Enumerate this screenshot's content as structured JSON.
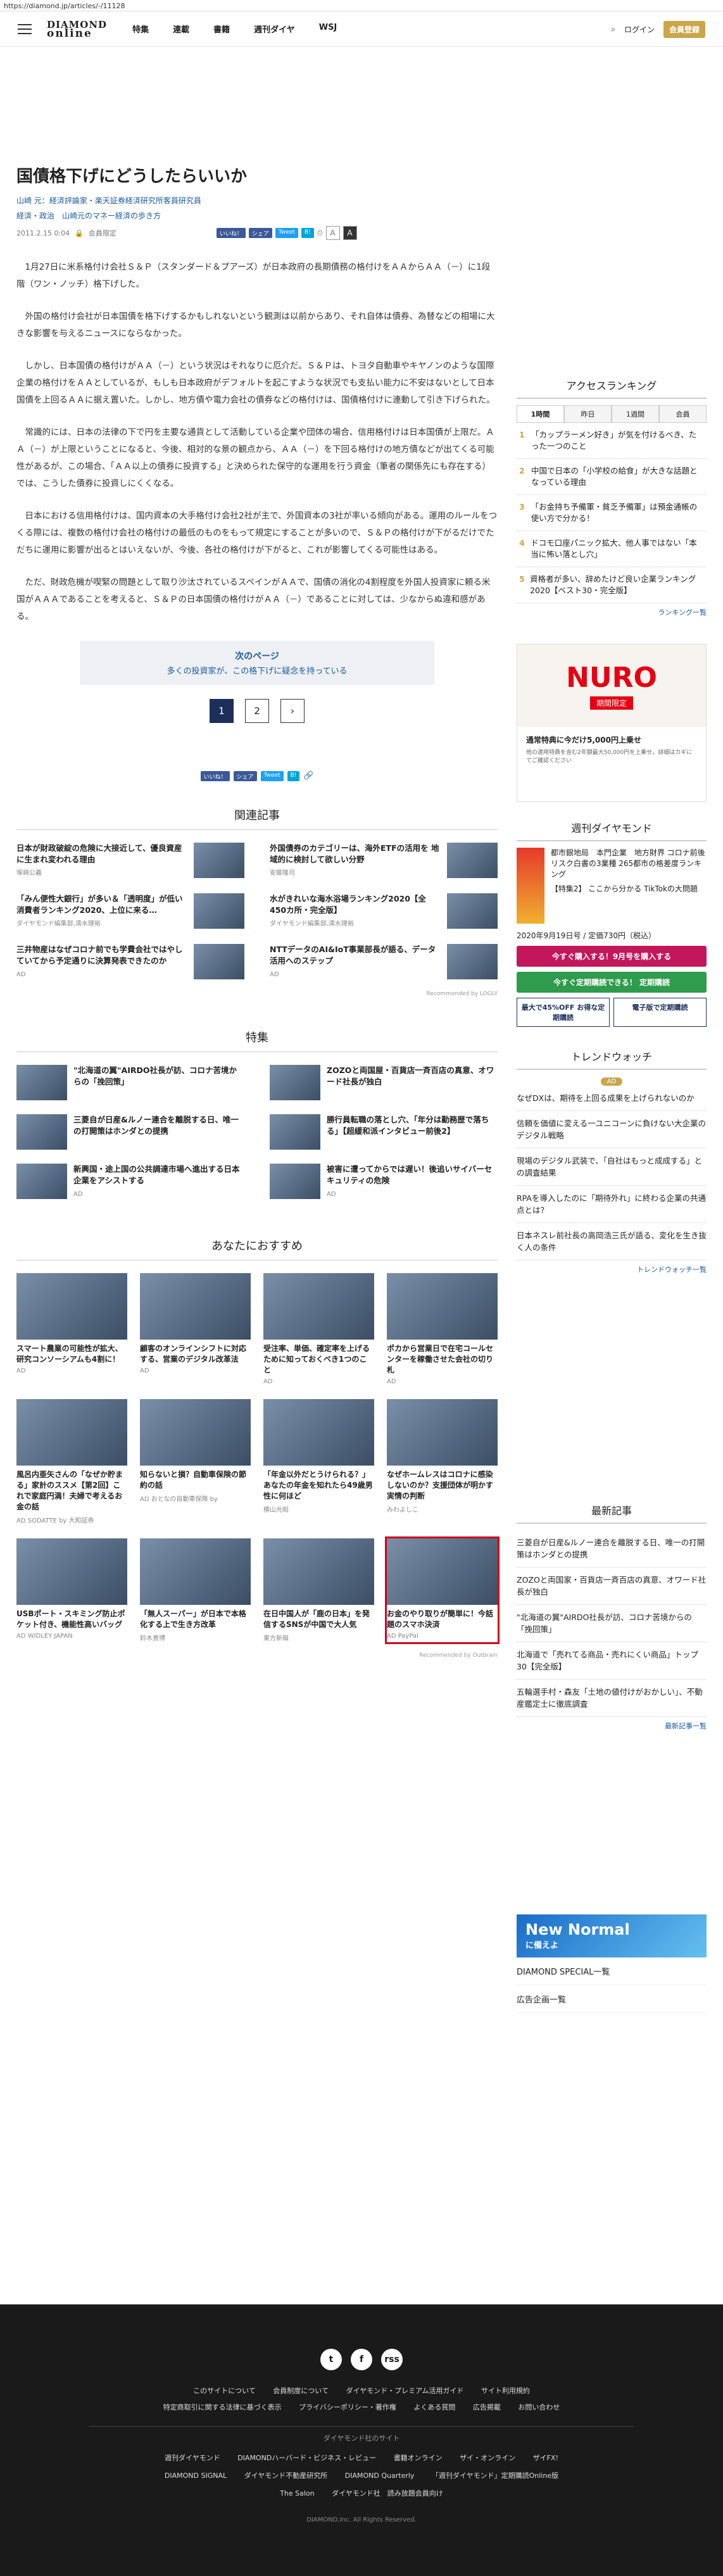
{
  "url": "https://diamond.jp/articles/-/11128",
  "header": {
    "logo_line1": "DIAMOND",
    "logo_line2": "online",
    "nav": [
      "特集",
      "連載",
      "書籍",
      "週刊ダイヤ",
      "WSJ"
    ],
    "login": "ログイン",
    "member": "会員登録"
  },
  "article": {
    "title": "国債格下げにどうしたらいいか",
    "author": "山崎 元：経済評論家・楽天証券経済研究所客員研究員",
    "categories": "経済・政治　山崎元のマネー経済の歩き方",
    "date": "2011.2.15 0:04",
    "print_label": "会員限定",
    "share": {
      "fb": "いいね！",
      "share": "シェア",
      "tweet": "Tweet",
      "hatena": "B!"
    },
    "font_sizes": [
      "A",
      "A"
    ],
    "paragraphs": [
      "1月27日に米系格付け会社Ｓ＆Ｐ（スタンダード＆プアーズ）が日本政府の長期債務の格付けをＡＡからＡＡ（－）に1段階（ワン・ノッチ）格下げした。",
      "外国の格付け会社が日本国債を格下げするかもしれないという観測は以前からあり、それ自体は債券、為替などの相場に大きな影響を与えるニュースにならなかった。",
      "しかし、日本国債の格付けがＡＡ（－）という状況はそれなりに厄介だ。Ｓ＆Ｐは、トヨタ自動車やキヤノンのような国際企業の格付けをＡＡとしているが、もしも日本政府がデフォルトを起こすような状況でも支払い能力に不安はないとして日本国債を上回るＡＡに据え置いた。しかし、地方債や電力会社の債券などの格付けは、国債格付けに連動して引き下げられた。",
      "常識的には、日本の法律の下で円を主要な通貨として活動している企業や団体の場合、信用格付けは日本国債が上限だ。ＡＡ（－）が上限ということになると、今後、相対的な景の観点から、ＡＡ（－）を下回る格付けの地方債などが出てくる可能性があるが、この場合、「ＡＡ以上の債券に投資する」と決められた保守的な運用を行う資金（筆者の関係先にも存在する）では、こうした債券に投資しにくくなる。",
      "日本における信用格付けは、国内資本の大手格付け会社2社が主で、外国資本の3社が率いる傾向がある。運用のルールをつくる際には、複数の格付け会社の格付けの最低のものをもって規定にすることが多いので、Ｓ＆Ｐの格付けが下がるだけでただちに運用に影響が出るとはいえないが、今後、各社の格付けが下がると、これが影響してくる可能性はある。",
      "ただ、財政危機が喫緊の問題として取り沙汰されているスペインがＡＡで、国債の消化の4割程度を外国人投資家に頼る米国がＡＡＡであることを考えると、Ｓ＆Ｐの日本国債の格付けがＡＡ（－）であることに対しては、少なからぬ違和感がある。"
    ],
    "next_page_label": "次のページ",
    "next_page_teaser": "多くの投資家が、この格下げに疑念を持っている",
    "pages": [
      "1",
      "2",
      "›"
    ]
  },
  "related": {
    "heading": "関連記事",
    "items": [
      {
        "title": "日本が財政破綻の危険に大接近して、優良資産に生まれ変われる理由",
        "source": "塚崎公義"
      },
      {
        "title": "外国債券のカテゴリーは、海外ETFの活用を 地域的に検討して欲しい分野",
        "source": "安藤隆司"
      },
      {
        "title": "「みん便性大銀行」が多い＆「透明度」が低い消費者ランキング2020、上位に来る…",
        "source": "ダイヤモンド編集部,清水理裕"
      },
      {
        "title": "水がきれいな海水浴場ランキング2020【全450カ所・完全版】",
        "source": "ダイヤモンド編集部,清水理裕"
      },
      {
        "title": "三井物産はなぜコロナ前でも学費会社ではやしていてから予定通りに決算発表できたのか",
        "source": "AD"
      },
      {
        "title": "NTTデータのAI&IoT事業部長が語る、データ活用へのステップ",
        "source": "AD"
      }
    ],
    "powered": "Recommended by LOGLY"
  },
  "feature": {
    "heading": "特集",
    "items": [
      {
        "title": "\"北海道の翼\"AIRDO社長が訪、コロナ苦境からの「挽回策」",
        "source": ""
      },
      {
        "title": "ZOZOと両国屋・百貨店一斉百店の真意、オワード社長が独白",
        "source": ""
      },
      {
        "title": "三菱自が日産&ルノー連合を離脱する日、唯一の打開策はホンダとの提携",
        "source": ""
      },
      {
        "title": "勝行員転職の落とし穴、「年分は勤務歴で落ちる」【超緩和派インタビュー前後2】",
        "source": ""
      },
      {
        "title": "新興国・途上国の公共調達市場へ進出する日本企業をアシストする",
        "source": "AD"
      },
      {
        "title": "被害に遭ってからでは遅い！後追いサイバーセキュリティの危険",
        "source": "AD"
      }
    ]
  },
  "recommend": {
    "heading": "あなたにおすすめ",
    "items": [
      {
        "title": "スマート農業の可能性が拡大、研究コンソーシアムも4割に！",
        "source": "AD"
      },
      {
        "title": "顧客のオンラインシフトに対応する、営業のデジタル改革法",
        "source": "AD"
      },
      {
        "title": "受注率、単価、確定率を上げるために知っておくべき1つのこと",
        "source": "AD"
      },
      {
        "title": "ポカから営業日で在宅コールセンターを稼働させた会社の切り札",
        "source": "AD"
      },
      {
        "title": "風呂内亜矢さんの「なぜか貯まる」家計のススメ【第2回】これで家庭円満！夫婦で考えるお金の話",
        "source": "AD SODATTE by 大和証券"
      },
      {
        "title": "知らないと損？自動車保険の節約の話",
        "source": "AD おとなの自動車保険 by"
      },
      {
        "title": "「年金以外だとうけられる？」あなたの年金を知れたら49歳男性に何ほど",
        "source": "横山光昭"
      },
      {
        "title": "なぜホームレスはコロナに感染しないのか？支援団体が明かす実情の判断",
        "source": "みわよしこ"
      },
      {
        "title": "USBポート・スキミング防止ポケット付き、機能性高いバッグ",
        "source": "AD WIDLEY JAPAN"
      },
      {
        "title": "「無人スーパー」が日本で本格化する上で生き方改革",
        "source": "鈴木貴博"
      },
      {
        "title": "在日中国人が「鹿の日本」を発信するSNSが中国で大人気",
        "source": "東方新報"
      },
      {
        "title": "お金のやり取りが簡単に！今話題のスマホ決済",
        "source": "AD PayPal"
      }
    ],
    "powered": "Recommended by Outbrain"
  },
  "sidebar": {
    "ranking_heading": "アクセスランキング",
    "ranking_tabs": [
      "1時間",
      "昨日",
      "1週間",
      "会員"
    ],
    "ranking": [
      "「カップラーメン好き」が気を付けるべき、たった一つのこと",
      "中国で日本の「小学校の給食」が大きな話題となっている理由",
      "「お金持ち予備軍・貧乏予備軍」は預金通帳の使い方で分かる！",
      "ドコモ口座パニック拡大、他人事ではない「本当に怖い落とし穴」",
      "資格者が多い、辞めたけど良い企業ランキング2020【ベスト30・完全版】"
    ],
    "ranking_more": "ランキング一覧",
    "ad": {
      "logo": "NURO",
      "limit": "期間限定",
      "headline": "通常特典に今だけ5,000円上乗せ",
      "note": "他の適用特典を含む2年額最大50,000円を上乗せ。詳細はカギにてご確認ください"
    },
    "weekly_heading": "週刊ダイヤモンド",
    "weekly_info": "都市銀地局　本門企業　地方財界 コロナ前後リスク白書の3業種 265都市の格差度ランキング",
    "weekly_special": "【特集2】 ここから分かる TikTokの大問題",
    "weekly_price": "2020年9月19日号 / 定価730円（税込）",
    "buy_label": "今すぐ購入する！9月号を購入する",
    "trial_label": "今すぐ定期購読できる！ 定期購読",
    "btn_left": "最大で45%OFF お得な定期購読",
    "btn_right": "電子版で定期購読",
    "trend_heading": "トレンドウォッチ",
    "trend_tag": "AD",
    "trend": [
      "なぜDXは、期待を上回る成果を上げられないのか",
      "信頼を価値に変える一ユニコーンに負けない大企業のデジタル戦略",
      "現場のデジタル武装で、「自社はもっと成成する」との調査結果",
      "RPAを導入したのに「期待外れ」に終わる企業の共通点とは？",
      "日本ネスレ前社長の高岡浩三氏が語る、変化を生き抜く人の条件"
    ],
    "trend_more": "トレンドウォッチ一覧",
    "latest_heading": "最新記事",
    "latest": [
      "三菱自が日産&ルノー連合を離脱する日、唯一の打開策はホンダとの提携",
      "ZOZOと両国家・百貨店一斉百店の真意、オワード社長が独白",
      "\"北海道の翼\"AIRDO社長が訪、コロナ苦境からの「挽回策」",
      "北海道で「売れてる商品・売れにくい商品」トップ30【完全版】",
      "五輪選手村・森友「土地の値付けがおかしい」、不動産鑑定士に徹底調査"
    ],
    "latest_more": "最新記事一覧",
    "newnormal_line1": "New Normal",
    "newnormal_line2": "に備えよ",
    "links": [
      "DIAMOND SPECIAL一覧",
      "広告企画一覧"
    ]
  },
  "footer": {
    "social": [
      "t",
      "f",
      "rss"
    ],
    "links_row1": [
      "このサイトについて",
      "会員制度について",
      "ダイヤモンド・プレミアム活用ガイド",
      "サイト利用規約"
    ],
    "links_row2": [
      "特定商取引に関する法律に基づく表示",
      "プライバシーポリシー・著作権",
      "よくある質問",
      "広告掲載",
      "お問い合わせ"
    ],
    "group_label": "ダイヤモンド社のサイト",
    "sites_row1": [
      "週刊ダイヤモンド",
      "DIAMONDハーバード・ビジネス・レビュー",
      "書籍オンライン",
      "ザイ・オンライン",
      "ザイFX!"
    ],
    "sites_row2": [
      "DIAMOND SIGNAL",
      "ダイヤモンド不動産研究所",
      "DIAMOND Quarterly",
      "「週刊ダイヤモンド」定期購読Online版"
    ],
    "sites_row3": [
      "The Salon",
      "ダイヤモンド社　読み放題会員向け"
    ],
    "copyright": "DIAMOND,Inc. All Rights Reserved."
  }
}
